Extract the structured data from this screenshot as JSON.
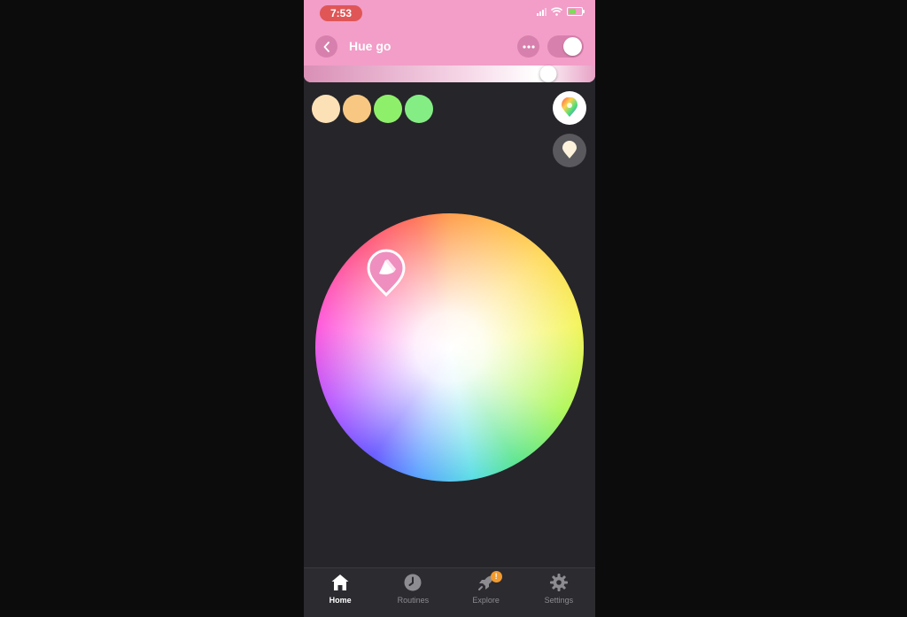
{
  "status_bar": {
    "time": "7:53"
  },
  "header": {
    "title": "Hue go",
    "toggle_on": true,
    "brightness_fraction": 0.84
  },
  "swatches": [
    {
      "name": "swatch-warm-light",
      "color": "#fde1b6"
    },
    {
      "name": "swatch-warm-orange",
      "color": "#f8c882"
    },
    {
      "name": "swatch-green",
      "color": "#8ef06a"
    },
    {
      "name": "swatch-light-green",
      "color": "#84ee84"
    }
  ],
  "modes": {
    "color_icon": "color-wheel-icon",
    "white_icon": "white-ambiance-icon"
  },
  "picker": {
    "icon": "lamp-icon",
    "color": "#ef8fbf"
  },
  "accent": "#f29ec8",
  "tabs": [
    {
      "label": "Home",
      "icon": "home-icon",
      "active": true
    },
    {
      "label": "Routines",
      "icon": "clock-icon",
      "active": false
    },
    {
      "label": "Explore",
      "icon": "rocket-icon",
      "active": false,
      "badge": "!"
    },
    {
      "label": "Settings",
      "icon": "gear-icon",
      "active": false
    }
  ]
}
